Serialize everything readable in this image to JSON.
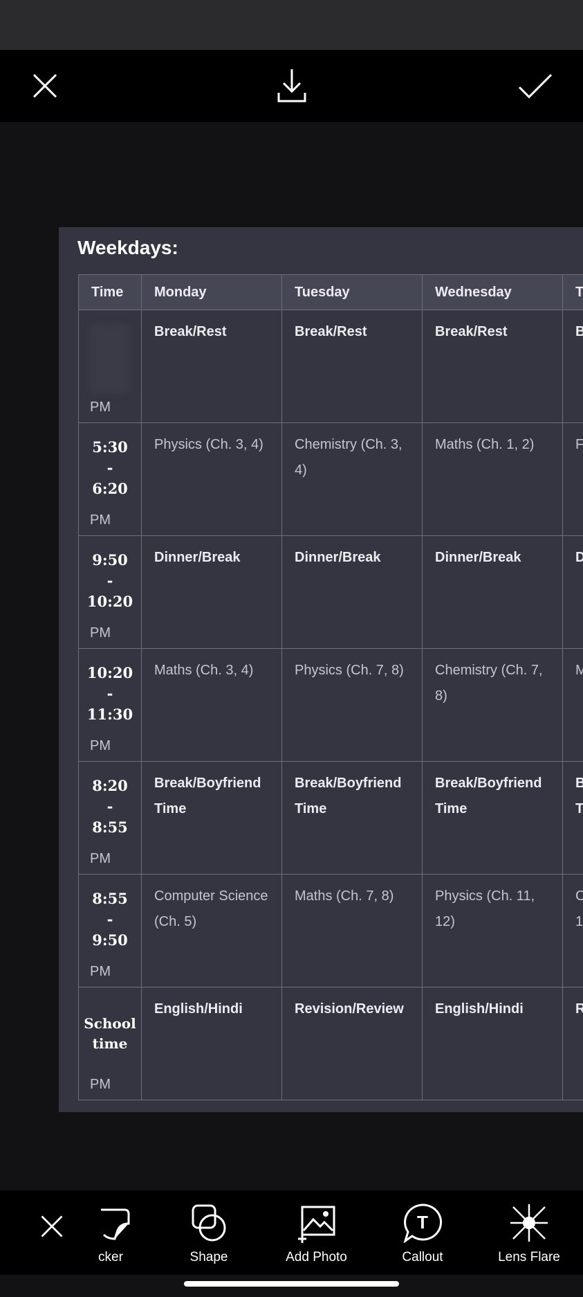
{
  "table": {
    "title": "Weekdays:",
    "headers": [
      "Time",
      "Monday",
      "Tuesday",
      "Wednesday",
      "T"
    ],
    "rows": [
      {
        "time": "",
        "pm": "PM",
        "cells": [
          "Break/Rest",
          "Break/Rest",
          "Break/Rest",
          "B"
        ],
        "bold": true
      },
      {
        "time": "5:30\n-\n6:20",
        "pm": "PM",
        "cells": [
          "Physics (Ch. 3, 4)",
          "Chemistry (Ch. 3, 4)",
          "Maths (Ch. 1, 2)",
          "F"
        ],
        "bold": false
      },
      {
        "time": "9:50\n-\n10:20",
        "pm": "PM",
        "cells": [
          "Dinner/Break",
          "Dinner/Break",
          "Dinner/Break",
          "D"
        ],
        "bold": true
      },
      {
        "time": "10:20\n-\n11:30",
        "pm": "PM",
        "cells": [
          "Maths (Ch. 3, 4)",
          "Physics (Ch. 7, 8)",
          "Chemistry (Ch. 7, 8)",
          "M"
        ],
        "bold": false
      },
      {
        "time": "8:20\n-\n8:55",
        "pm": "PM",
        "cells": [
          "Break/Boyfriend Time",
          "Break/Boyfriend Time",
          "Break/Boyfriend Time",
          "B\nT"
        ],
        "bold": true
      },
      {
        "time": "8:55\n-\n9:50",
        "pm": "PM",
        "cells": [
          "Computer Science (Ch. 5)",
          "Maths (Ch. 7, 8)",
          "Physics (Ch. 11, 12)",
          "C\n1("
        ],
        "bold": false
      },
      {
        "time": "School\ntime",
        "pm": "PM",
        "cells": [
          "English/Hindi",
          "Revision/Review",
          "English/Hindi",
          "R"
        ],
        "bold": true
      }
    ]
  },
  "toolbar": {
    "cancel_icon": "close-icon",
    "sticker_label": "cker",
    "shape_label": "Shape",
    "photo_label": "Add Photo",
    "callout_label": "Callout",
    "callout_glyph": "T",
    "flare_label": "Lens Flare"
  },
  "topbar": {
    "close_icon": "close-icon",
    "download_icon": "download-icon",
    "confirm_icon": "checkmark-icon"
  },
  "colors": {
    "card_bg": "#343541",
    "header_bg": "#464754",
    "page_bg": "#121214"
  }
}
